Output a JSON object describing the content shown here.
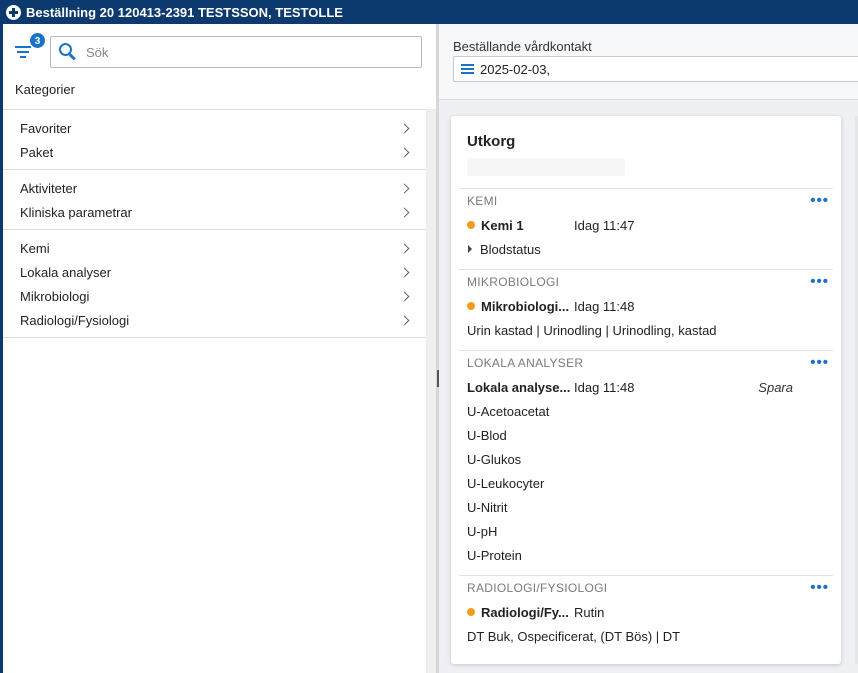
{
  "titlebar": {
    "title": "Beställning 20 120413-2391 TESTSSON, TESTOLLE"
  },
  "left": {
    "filter_badge": "3",
    "search_placeholder": "Sök",
    "categories_heading": "Kategorier",
    "groups": [
      [
        "Favoriter",
        "Paket"
      ],
      [
        "Aktiviteter",
        "Kliniska parametrar"
      ],
      [
        "Kemi",
        "Lokala analyser",
        "Mikrobiologi",
        "Radiologi/Fysiologi"
      ]
    ]
  },
  "right": {
    "contact_label": "Beställande vårdkontakt",
    "contact_value": "2025-02-03,",
    "card": {
      "title": "Utkorg",
      "sections": {
        "kemi": {
          "header": "KEMI",
          "item": "Kemi 1",
          "time": "Idag 11:47",
          "sub": "Blodstatus"
        },
        "mikro": {
          "header": "MIKROBIOLOGI",
          "item": "Mikrobiologi...",
          "time": "Idag 11:48",
          "sub": "Urin kastad | Urinodling | Urinodling, kastad"
        },
        "lokala": {
          "header": "LOKALA ANALYSER",
          "item": "Lokala analyse...",
          "time": "Idag 11:48",
          "action": "Spara",
          "tests": [
            "U-Acetoacetat",
            "U-Blod",
            "U-Glukos",
            "U-Leukocyter",
            "U-Nitrit",
            "U-pH",
            "U-Protein"
          ]
        },
        "radio": {
          "header": "RADIOLOGI/FYSIOLOGI",
          "item": "Radiologi/Fy...",
          "time": "Rutin",
          "sub": "DT Buk, Ospecificerat, (DT Bös) | DT"
        }
      }
    }
  },
  "colors": {
    "title_bg": "#0d3a6e",
    "accent": "#1a73c8",
    "status_dot": "#f29c1f"
  },
  "icons": {
    "app": "app-cross-icon",
    "filter": "filter-icon",
    "search": "search-icon",
    "chevron": "chevron-right-icon",
    "list": "list-icon",
    "more": "more-horizontal-icon",
    "expand": "caret-right-icon"
  }
}
